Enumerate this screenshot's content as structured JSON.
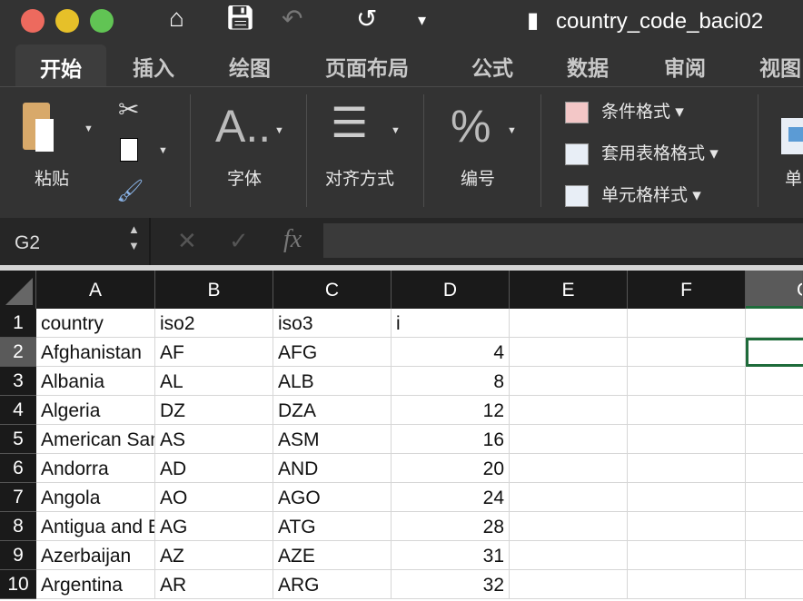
{
  "window": {
    "title": "country_code_baci02",
    "colors": {
      "close": "#ed6a5e",
      "minimize": "#e6c029",
      "maximize": "#61c454",
      "selection": "#1e6b3a"
    }
  },
  "tabs": [
    "开始",
    "插入",
    "绘图",
    "页面布局",
    "公式",
    "数据",
    "审阅",
    "视图"
  ],
  "ribbon": {
    "paste": "粘贴",
    "font": "字体",
    "alignment": "对齐方式",
    "number": "编号",
    "conditional_format": "条件格式",
    "format_as_table": "套用表格格式",
    "cell_styles": "单元格样式",
    "cells": "单"
  },
  "formula_bar": {
    "name_box": "G2",
    "fx": "fx",
    "value": ""
  },
  "columns": [
    "A",
    "B",
    "C",
    "D",
    "E",
    "F",
    "G"
  ],
  "rows": [
    {
      "n": "1",
      "a": "country",
      "b": "iso2",
      "c": "iso3",
      "d": "i",
      "d_text": true
    },
    {
      "n": "2",
      "a": "Afghanistan",
      "b": "AF",
      "c": "AFG",
      "d": "4"
    },
    {
      "n": "3",
      "a": "Albania",
      "b": "AL",
      "c": "ALB",
      "d": "8"
    },
    {
      "n": "4",
      "a": "Algeria",
      "b": "DZ",
      "c": "DZA",
      "d": "12"
    },
    {
      "n": "5",
      "a": "American Samoa",
      "b": "AS",
      "c": "ASM",
      "d": "16"
    },
    {
      "n": "6",
      "a": "Andorra",
      "b": "AD",
      "c": "AND",
      "d": "20"
    },
    {
      "n": "7",
      "a": "Angola",
      "b": "AO",
      "c": "AGO",
      "d": "24"
    },
    {
      "n": "8",
      "a": "Antigua and Barbuda",
      "b": "AG",
      "c": "ATG",
      "d": "28"
    },
    {
      "n": "9",
      "a": "Azerbaijan",
      "b": "AZ",
      "c": "AZE",
      "d": "31"
    },
    {
      "n": "10",
      "a": "Argentina",
      "b": "AR",
      "c": "ARG",
      "d": "32"
    }
  ]
}
